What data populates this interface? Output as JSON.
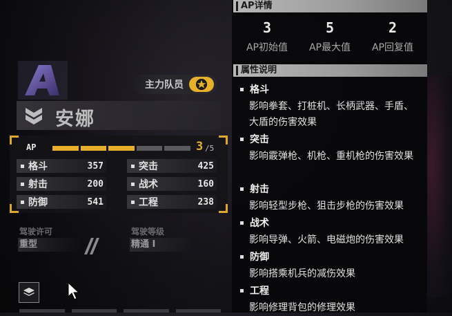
{
  "character": {
    "rank": "A",
    "role_badge": "主力队员",
    "name": "安娜"
  },
  "ap": {
    "label": "AP",
    "current": "3",
    "max": "/5",
    "filled_segments": 3,
    "total_segments": 5
  },
  "stats": [
    {
      "name": "格斗",
      "value": "357"
    },
    {
      "name": "突击",
      "value": "425"
    },
    {
      "name": "射击",
      "value": "200"
    },
    {
      "name": "战术",
      "value": "160"
    },
    {
      "name": "防御",
      "value": "541"
    },
    {
      "name": "工程",
      "value": "238"
    }
  ],
  "license": {
    "label": "驾驶许可",
    "value": "重型"
  },
  "level": {
    "label": "驾驶等级",
    "value": "精通 I"
  },
  "ap_details": {
    "header": "AP详情",
    "items": [
      {
        "value": "3",
        "label": "AP初始值"
      },
      {
        "value": "5",
        "label": "AP最大值"
      },
      {
        "value": "2",
        "label": "AP回复值"
      }
    ]
  },
  "attr_desc": {
    "header": "属性说明",
    "items": [
      {
        "name": "格斗",
        "desc": "影响拳套、打桩机、长柄武器、手盾、大盾的伤害效果"
      },
      {
        "name": "突击",
        "desc": "影响霰弹枪、机枪、重机枪的伤害效果"
      },
      {
        "name": "射击",
        "desc": "影响轻型步枪、狙击步枪的伤害效果"
      },
      {
        "name": "战术",
        "desc": "影响导弹、火箭、电磁炮的伤害效果"
      },
      {
        "name": "防御",
        "desc": "影响搭乘机兵的减伤效果"
      },
      {
        "name": "工程",
        "desc": "影响修理背包的修理效果"
      }
    ]
  },
  "colors": {
    "accent": "#e8b02a",
    "panel_header": "#b8b8b8"
  },
  "icons": [
    "rank-a-emblem",
    "star-icon",
    "chevron-rank-icon",
    "stripes-icon",
    "layers-icon",
    "cursor-icon"
  ]
}
